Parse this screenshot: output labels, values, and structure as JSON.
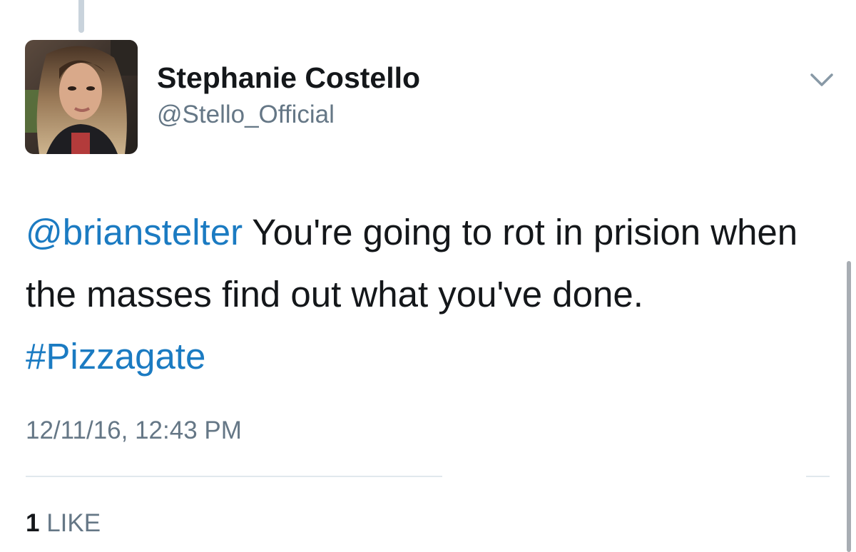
{
  "author": {
    "display_name": "Stephanie Costello",
    "handle": "@Stello_Official"
  },
  "tweet": {
    "mention": "@brianstelter",
    "text": " You're going to rot in prision when the masses find out what you've done. ",
    "hashtag": "#Pizzagate",
    "timestamp": "12/11/16, 12:43 PM"
  },
  "stats": {
    "likes_count": "1",
    "likes_label": "LIKE"
  },
  "icons": {
    "menu": "chevron-down-icon"
  },
  "colors": {
    "link": "#1b7bc2",
    "text": "#14171a",
    "secondary": "#657786"
  }
}
